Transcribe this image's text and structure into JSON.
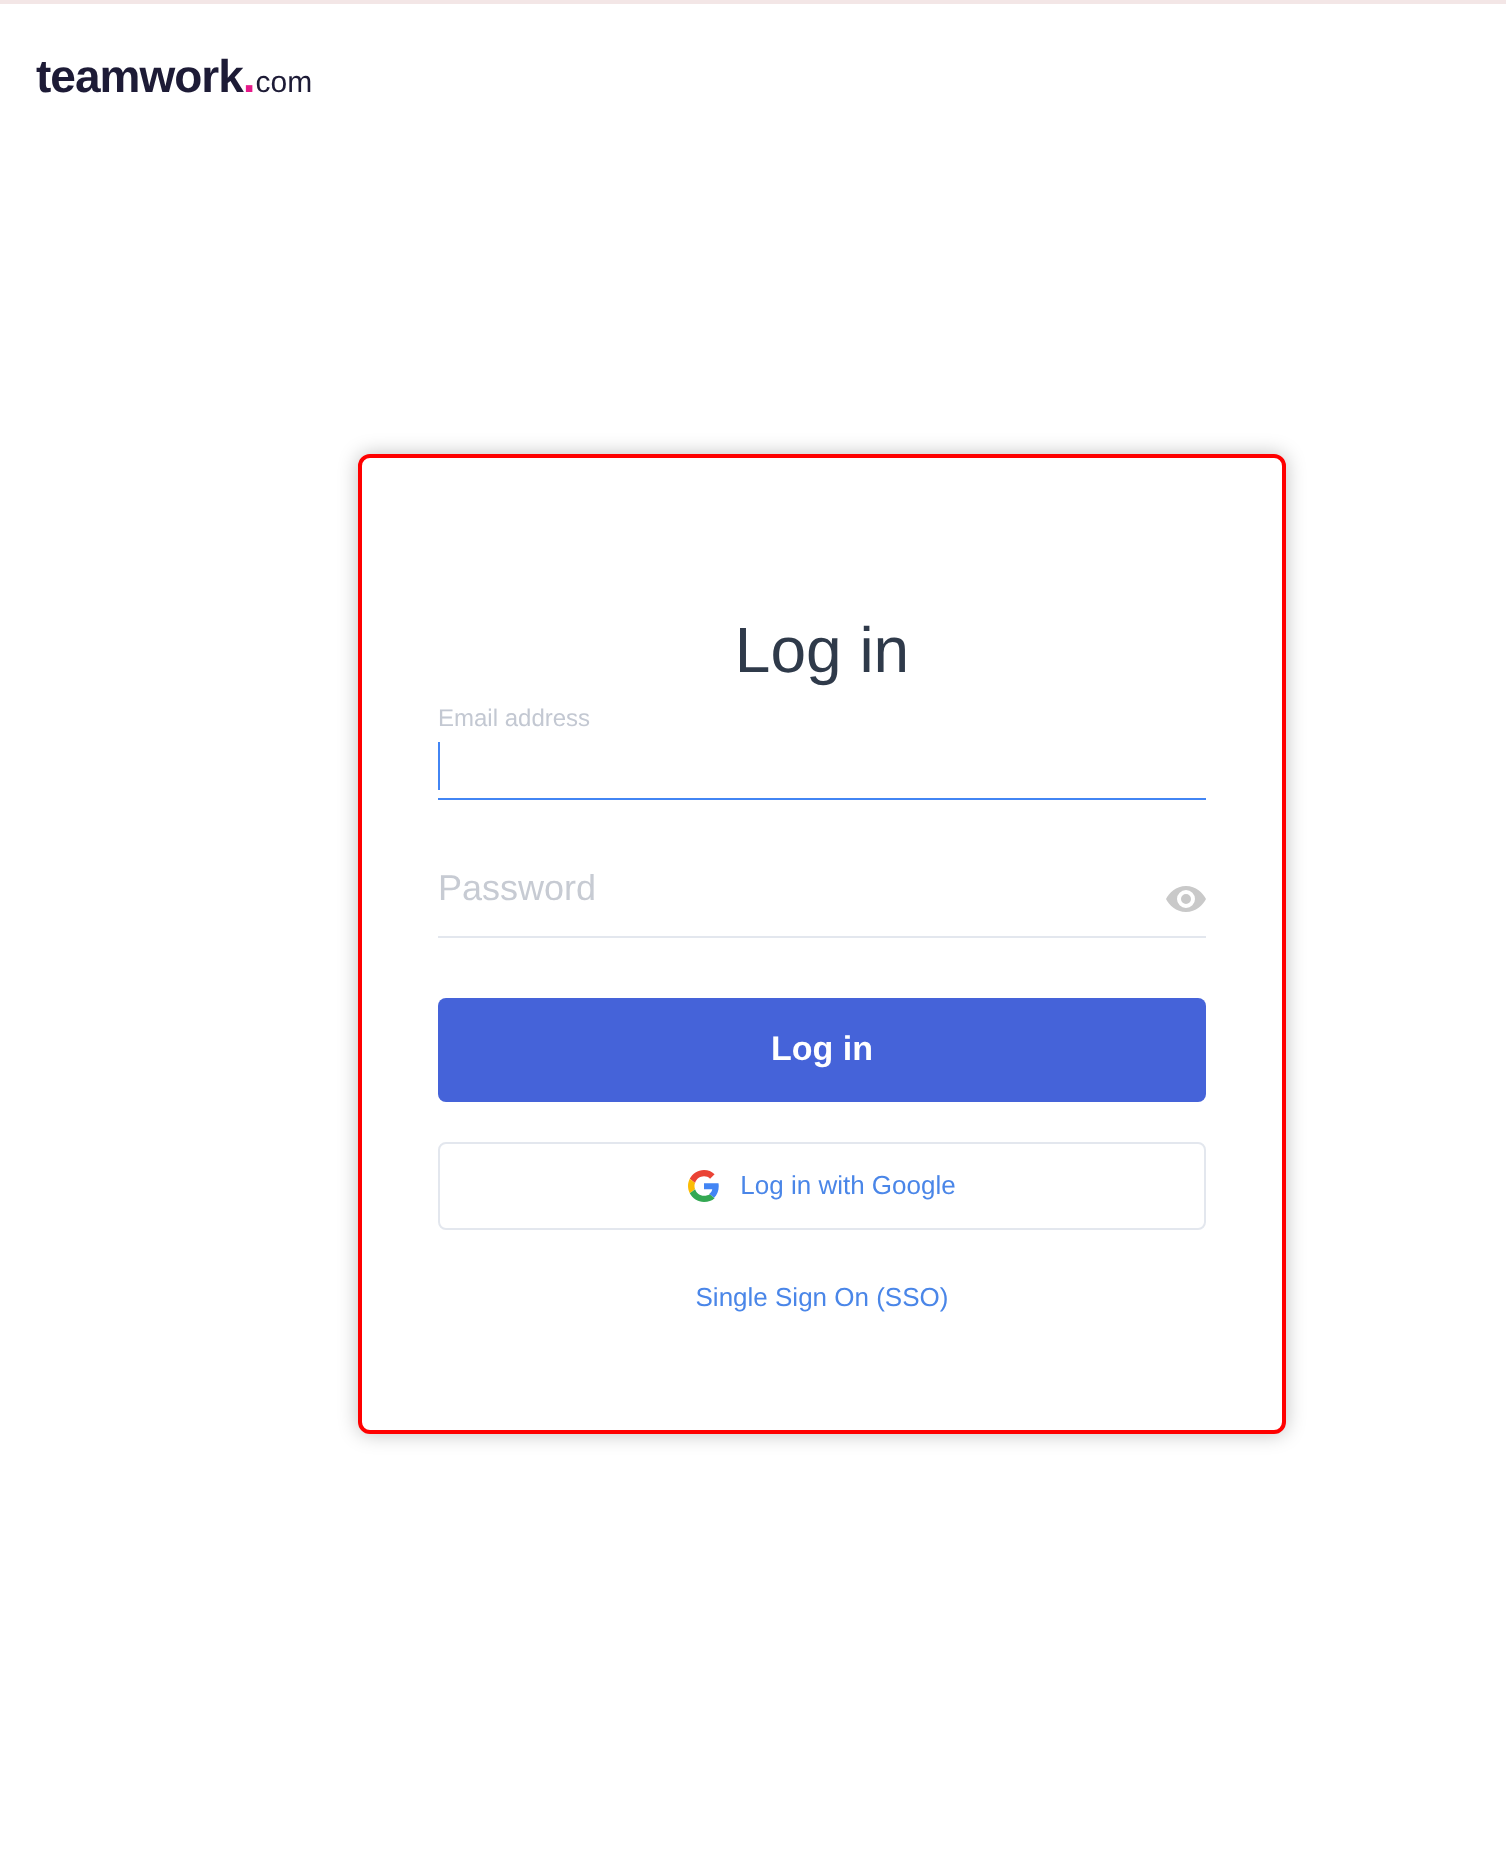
{
  "logo": {
    "name": "teamwork",
    "dot": ".",
    "suffix": "com"
  },
  "form": {
    "title": "Log in",
    "email": {
      "label": "Email address",
      "focused": true
    },
    "password": {
      "placeholder": "Password"
    },
    "submit": "Log in",
    "google": "Log in with Google",
    "sso": "Single Sign On (SSO)"
  }
}
